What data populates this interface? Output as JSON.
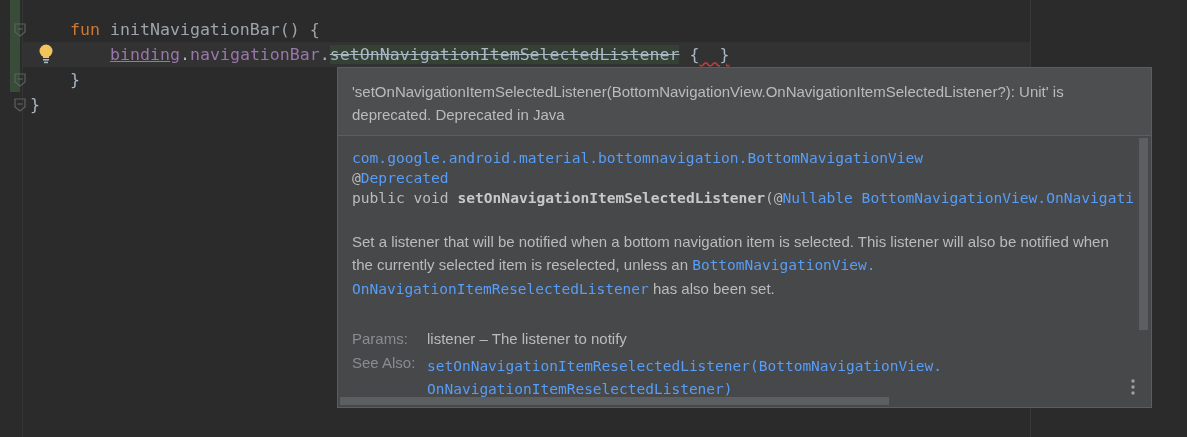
{
  "editor": {
    "lines": [
      {
        "children": [
          {
            "current": false,
            "bulb": false,
            "tokens": [
              {
                "text": "fun ",
                "kind": "keyword"
              },
              {
                "text": "initNavigationBar() {",
                "kind": "function"
              }
            ],
            "children": [
              {
                "current": true,
                "bulb": true,
                "tokens": [
                  {
                    "text": "binding",
                    "kind": "underlined"
                  },
                  {
                    "text": ".",
                    "kind": "plain"
                  },
                  {
                    "text": "navigationBar",
                    "kind": "property"
                  },
                  {
                    "text": ".",
                    "kind": "plain"
                  },
                  {
                    "text": "setOnNavigationItemSelectedListener",
                    "kind": "deprecated"
                  },
                  {
                    "text": " {",
                    "kind": "plain"
                  },
                  {
                    "text": "  }",
                    "kind": "error"
                  }
                ]
              }
            ]
          },
          {
            "current": false,
            "bulb": false,
            "tokens": [
              {
                "text": "}",
                "kind": "plain"
              }
            ]
          }
        ]
      },
      {
        "current": false,
        "bulb": false,
        "tokens": [
          {
            "text": "}",
            "kind": "plain"
          }
        ]
      }
    ]
  },
  "popup": {
    "header": "'setOnNavigationItemSelectedListener(BottomNavigationView.OnNavigationItemSelectedListener?): Unit' is deprecated. Deprecated in Java",
    "signature": [
      [
        {
          "text": "com.google.android.material.bottomnavigation.BottomNavigationView",
          "kind": "link"
        }
      ],
      [
        {
          "text": "@",
          "kind": "plain"
        },
        {
          "text": "Deprecated",
          "kind": "link"
        }
      ],
      [
        {
          "text": "public void ",
          "kind": "plain"
        },
        {
          "text": "setOnNavigationItemSelectedListener",
          "kind": "bold"
        },
        {
          "text": "(@",
          "kind": "plain"
        },
        {
          "text": "Nullable BottomNavigationView.OnNavigati",
          "kind": "link"
        }
      ]
    ],
    "description": [
      {
        "text": "Set a listener that will be notified when a bottom navigation item is selected. This listener will also be notified when the currently selected item is reselected, unless an ",
        "kind": "plain"
      },
      {
        "text": "BottomNavigationView.",
        "kind": "link"
      },
      {
        "text": "OnNavigationItemReselectedListener",
        "kind": "link"
      },
      {
        "text": " has also been set.",
        "kind": "plain"
      }
    ],
    "sections": [
      {
        "label": "Params:",
        "parts": [
          {
            "text": "listener – The listener to notify",
            "kind": "plain"
          }
        ]
      },
      {
        "label": "See Also:",
        "parts": [
          {
            "text": "setOnNavigationItemReselectedListener(BottomNavigationView.",
            "kind": "link"
          },
          {
            "text": "OnNavigationItemReselectedListener)",
            "kind": "link"
          }
        ]
      }
    ]
  }
}
